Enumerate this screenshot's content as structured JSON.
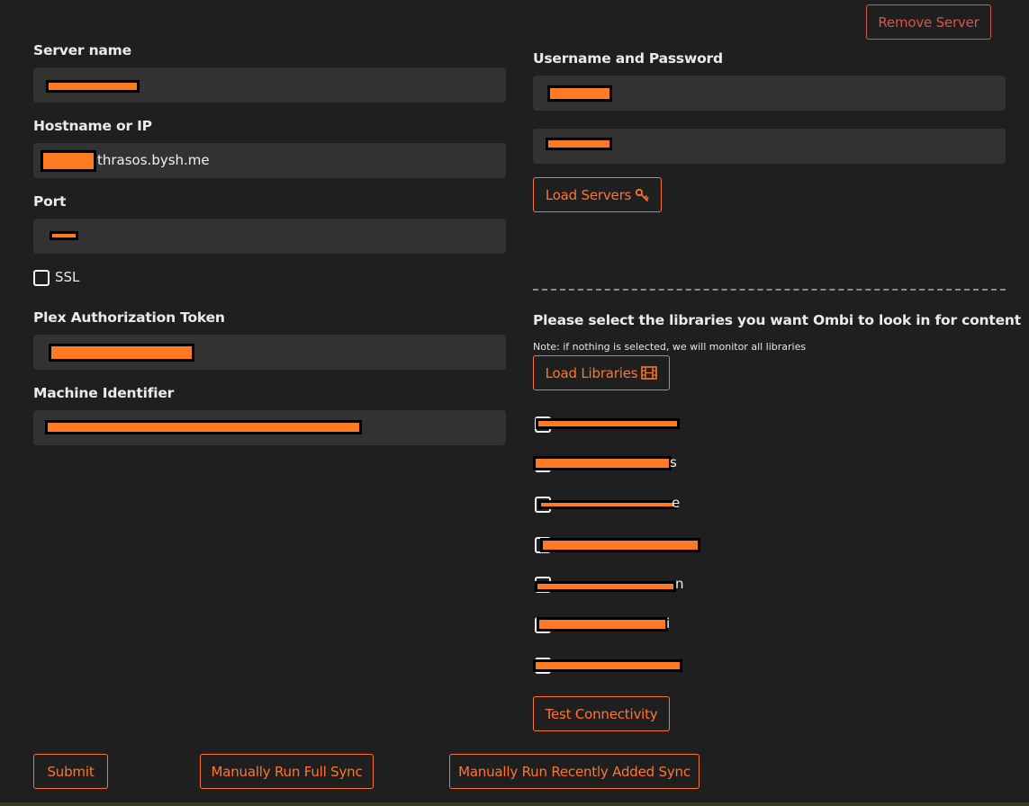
{
  "server": {
    "name_label": "Server name",
    "hostname_label": "Hostname or IP",
    "hostname_suffix": "thrasos.bysh.me",
    "port_label": "Port",
    "ssl_label": "SSL",
    "token_label": "Plex Authorization Token",
    "machine_id_label": "Machine Identifier"
  },
  "account": {
    "credentials_label": "Username and Password",
    "load_servers_label": "Load Servers"
  },
  "libraries": {
    "heading": "Please select the libraries you want Ombi to look in for content",
    "note": "Note: if nothing is selected, we will monitor all libraries",
    "load_libraries_label": "Load Libraries",
    "item_tails": [
      "",
      "s",
      "e",
      "",
      "n",
      "i",
      ""
    ]
  },
  "actions": {
    "remove_server": "Remove Server",
    "test_connectivity": "Test Connectivity",
    "submit": "Submit",
    "full_sync": "Manually Run Full Sync",
    "recent_sync": "Manually Run Recently Added Sync"
  },
  "colors": {
    "background": "#1f1f1f",
    "field": "#323232",
    "accent": "#ff7430",
    "danger": "#d9534f",
    "redaction": "#ff7a22"
  },
  "icons": {
    "load_servers": "key-icon",
    "load_libraries": "film-icon"
  }
}
